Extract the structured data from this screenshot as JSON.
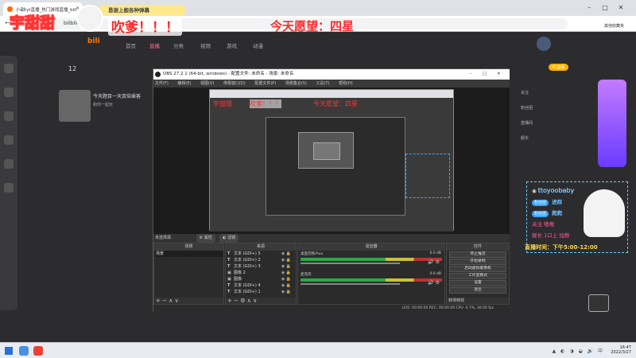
{
  "browser": {
    "tab_title": "小甜tyt直播_热门游戏直播_bili",
    "url": "bilibili.com",
    "favorites": "其他收藏夹"
  },
  "overlay": {
    "streamer_name": "宇甜甜",
    "banner": "恳谢上舰各种弹幕",
    "yell": "吹爹！！！",
    "wish": "今天愿望：四星"
  },
  "site": {
    "logo": "bili",
    "nav": [
      "首页",
      "直播",
      "分类",
      "视频",
      "游戏",
      "动漫"
    ],
    "count": "12",
    "card_title": "今天题目一天双倍乘客",
    "card_sub": "和你一起玩",
    "pc_badge": "PC直播",
    "right_items": [
      "关注",
      "粉丝团",
      "直播间",
      "舰长"
    ]
  },
  "obs": {
    "title": "OBS 27.2.1 (64-bit, windows) - 配置文件: 未命名 - 场景: 未命名",
    "menu": [
      "文件(F)",
      "编辑(E)",
      "视图(V)",
      "停靠窗口(D)",
      "配置文件(P)",
      "场景集合(S)",
      "工具(T)",
      "帮助(H)"
    ],
    "status_strip": {
      "left": "未选择源",
      "props": "属性",
      "filters": "滤镜"
    },
    "docks": {
      "scenes": "场景",
      "sources": "来源",
      "mixer": "混音器",
      "controls": "控件"
    },
    "scene_items": [
      "场景"
    ],
    "source_items": [
      {
        "label": "文本 (GDI+) 5",
        "type": "text"
      },
      {
        "label": "文本 (GDI+) 2",
        "type": "text"
      },
      {
        "label": "文本 (GDI+) 3",
        "type": "text"
      },
      {
        "label": "图像 2",
        "type": "image"
      },
      {
        "label": "图像",
        "type": "image"
      },
      {
        "label": "文本 (GDI+) 4",
        "type": "text"
      },
      {
        "label": "文本 (GDI+) 1",
        "type": "text"
      }
    ],
    "mixer_items": [
      {
        "name": "桌面音频/Aux",
        "db": "0.0 dB"
      },
      {
        "name": "麦克风",
        "db": "0.0 dB"
      }
    ],
    "control_buttons": [
      "停止推流",
      "开始录制",
      "启动虚拟摄像机",
      "工作室模式",
      "设置",
      "退出"
    ],
    "footer_controls": "转场特效",
    "status": "LIVE: 00:00:00   REC: 00:00:00   CPU: 0.7%, 30.00 fps"
  },
  "preview": {
    "mini_name": "宇甜甜",
    "mini_yell": "吹爹！！！",
    "mini_wish": "今天愿望：四星"
  },
  "chat": {
    "user": "ttoyoobaby",
    "rows": [
      {
        "tag": "粉丝团",
        "text": "进群"
      },
      {
        "tag": "粉丝团",
        "text": "爬爬"
      },
      {
        "tag": "",
        "text": "关注 嗷嗷"
      },
      {
        "tag": "",
        "text": "舰长 1口上 加群"
      }
    ],
    "schedule": "直播时间：下午5:00-12:00"
  },
  "taskbar": {
    "time": "16:47",
    "date": "2022/3/27",
    "lang": "中"
  },
  "colors": {
    "accent_red": "#ff2a2a",
    "obs_bg": "#2b2b2b",
    "chat_blue": "#3aa3ff"
  }
}
